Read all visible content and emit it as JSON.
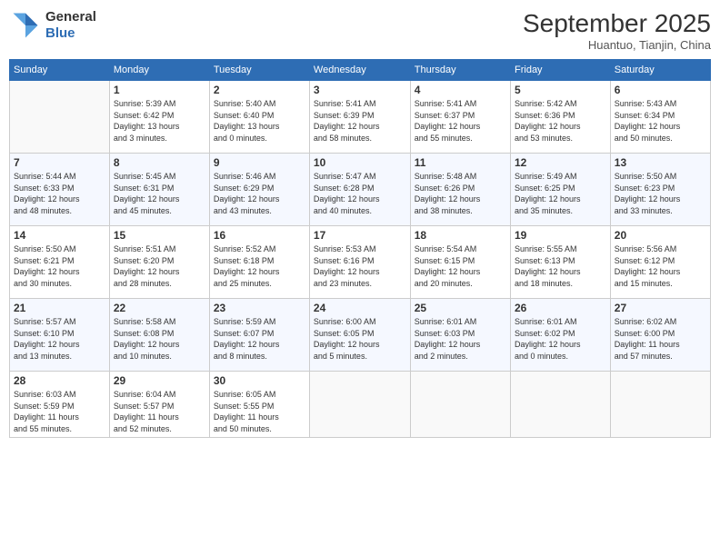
{
  "logo": {
    "general": "General",
    "blue": "Blue"
  },
  "title": "September 2025",
  "location": "Huantuo, Tianjin, China",
  "days_of_week": [
    "Sunday",
    "Monday",
    "Tuesday",
    "Wednesday",
    "Thursday",
    "Friday",
    "Saturday"
  ],
  "weeks": [
    [
      {
        "day": "",
        "info": ""
      },
      {
        "day": "1",
        "info": "Sunrise: 5:39 AM\nSunset: 6:42 PM\nDaylight: 13 hours\nand 3 minutes."
      },
      {
        "day": "2",
        "info": "Sunrise: 5:40 AM\nSunset: 6:40 PM\nDaylight: 13 hours\nand 0 minutes."
      },
      {
        "day": "3",
        "info": "Sunrise: 5:41 AM\nSunset: 6:39 PM\nDaylight: 12 hours\nand 58 minutes."
      },
      {
        "day": "4",
        "info": "Sunrise: 5:41 AM\nSunset: 6:37 PM\nDaylight: 12 hours\nand 55 minutes."
      },
      {
        "day": "5",
        "info": "Sunrise: 5:42 AM\nSunset: 6:36 PM\nDaylight: 12 hours\nand 53 minutes."
      },
      {
        "day": "6",
        "info": "Sunrise: 5:43 AM\nSunset: 6:34 PM\nDaylight: 12 hours\nand 50 minutes."
      }
    ],
    [
      {
        "day": "7",
        "info": "Sunrise: 5:44 AM\nSunset: 6:33 PM\nDaylight: 12 hours\nand 48 minutes."
      },
      {
        "day": "8",
        "info": "Sunrise: 5:45 AM\nSunset: 6:31 PM\nDaylight: 12 hours\nand 45 minutes."
      },
      {
        "day": "9",
        "info": "Sunrise: 5:46 AM\nSunset: 6:29 PM\nDaylight: 12 hours\nand 43 minutes."
      },
      {
        "day": "10",
        "info": "Sunrise: 5:47 AM\nSunset: 6:28 PM\nDaylight: 12 hours\nand 40 minutes."
      },
      {
        "day": "11",
        "info": "Sunrise: 5:48 AM\nSunset: 6:26 PM\nDaylight: 12 hours\nand 38 minutes."
      },
      {
        "day": "12",
        "info": "Sunrise: 5:49 AM\nSunset: 6:25 PM\nDaylight: 12 hours\nand 35 minutes."
      },
      {
        "day": "13",
        "info": "Sunrise: 5:50 AM\nSunset: 6:23 PM\nDaylight: 12 hours\nand 33 minutes."
      }
    ],
    [
      {
        "day": "14",
        "info": "Sunrise: 5:50 AM\nSunset: 6:21 PM\nDaylight: 12 hours\nand 30 minutes."
      },
      {
        "day": "15",
        "info": "Sunrise: 5:51 AM\nSunset: 6:20 PM\nDaylight: 12 hours\nand 28 minutes."
      },
      {
        "day": "16",
        "info": "Sunrise: 5:52 AM\nSunset: 6:18 PM\nDaylight: 12 hours\nand 25 minutes."
      },
      {
        "day": "17",
        "info": "Sunrise: 5:53 AM\nSunset: 6:16 PM\nDaylight: 12 hours\nand 23 minutes."
      },
      {
        "day": "18",
        "info": "Sunrise: 5:54 AM\nSunset: 6:15 PM\nDaylight: 12 hours\nand 20 minutes."
      },
      {
        "day": "19",
        "info": "Sunrise: 5:55 AM\nSunset: 6:13 PM\nDaylight: 12 hours\nand 18 minutes."
      },
      {
        "day": "20",
        "info": "Sunrise: 5:56 AM\nSunset: 6:12 PM\nDaylight: 12 hours\nand 15 minutes."
      }
    ],
    [
      {
        "day": "21",
        "info": "Sunrise: 5:57 AM\nSunset: 6:10 PM\nDaylight: 12 hours\nand 13 minutes."
      },
      {
        "day": "22",
        "info": "Sunrise: 5:58 AM\nSunset: 6:08 PM\nDaylight: 12 hours\nand 10 minutes."
      },
      {
        "day": "23",
        "info": "Sunrise: 5:59 AM\nSunset: 6:07 PM\nDaylight: 12 hours\nand 8 minutes."
      },
      {
        "day": "24",
        "info": "Sunrise: 6:00 AM\nSunset: 6:05 PM\nDaylight: 12 hours\nand 5 minutes."
      },
      {
        "day": "25",
        "info": "Sunrise: 6:01 AM\nSunset: 6:03 PM\nDaylight: 12 hours\nand 2 minutes."
      },
      {
        "day": "26",
        "info": "Sunrise: 6:01 AM\nSunset: 6:02 PM\nDaylight: 12 hours\nand 0 minutes."
      },
      {
        "day": "27",
        "info": "Sunrise: 6:02 AM\nSunset: 6:00 PM\nDaylight: 11 hours\nand 57 minutes."
      }
    ],
    [
      {
        "day": "28",
        "info": "Sunrise: 6:03 AM\nSunset: 5:59 PM\nDaylight: 11 hours\nand 55 minutes."
      },
      {
        "day": "29",
        "info": "Sunrise: 6:04 AM\nSunset: 5:57 PM\nDaylight: 11 hours\nand 52 minutes."
      },
      {
        "day": "30",
        "info": "Sunrise: 6:05 AM\nSunset: 5:55 PM\nDaylight: 11 hours\nand 50 minutes."
      },
      {
        "day": "",
        "info": ""
      },
      {
        "day": "",
        "info": ""
      },
      {
        "day": "",
        "info": ""
      },
      {
        "day": "",
        "info": ""
      }
    ]
  ]
}
